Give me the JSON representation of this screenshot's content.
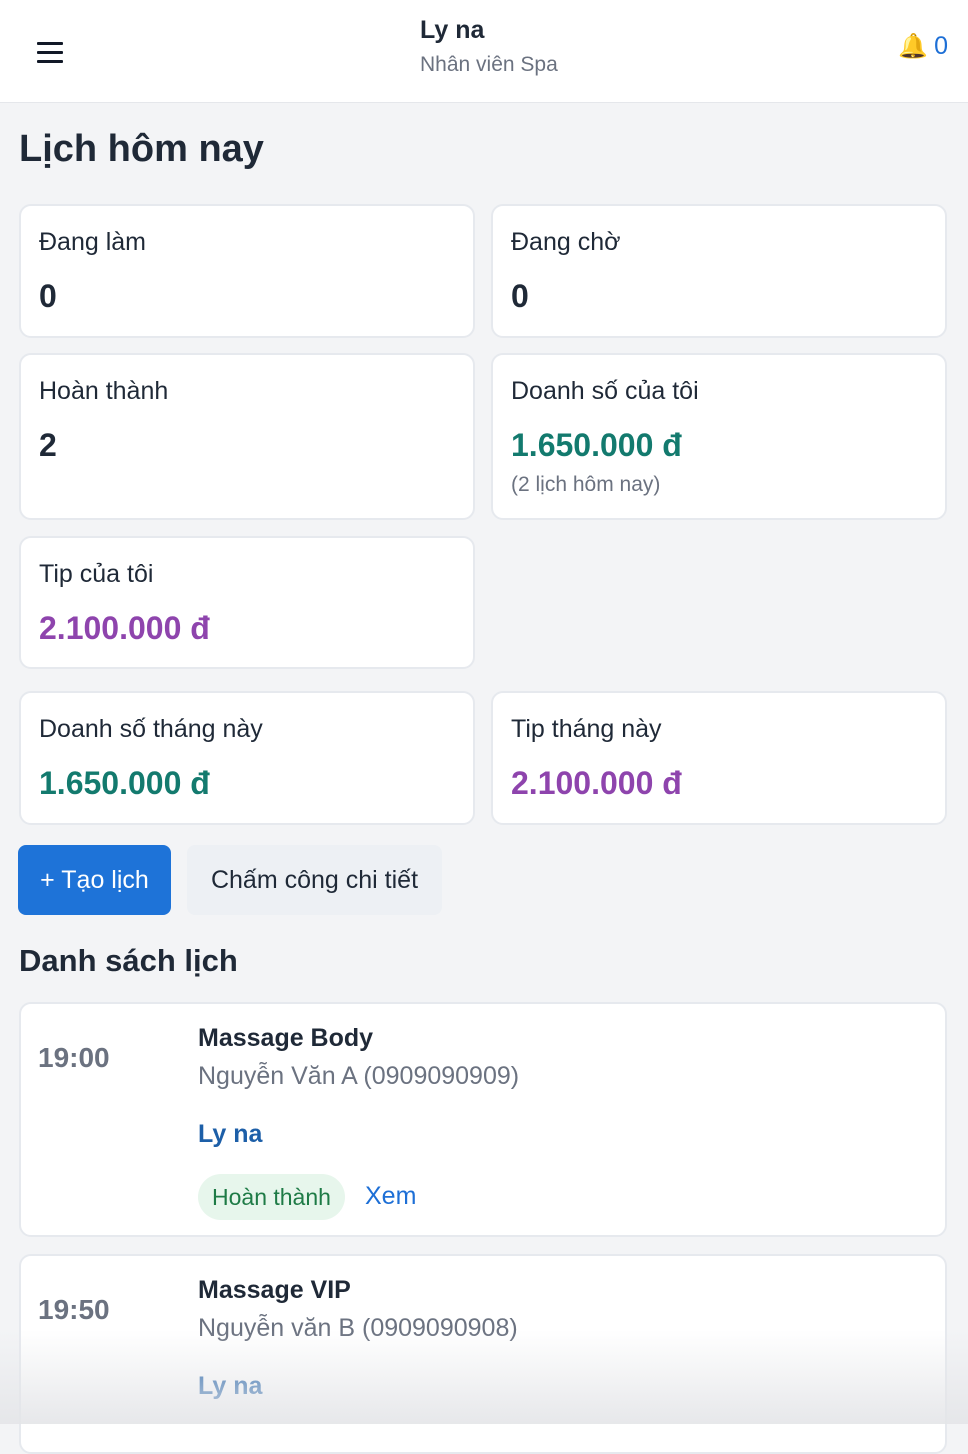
{
  "header": {
    "user_name": "Ly na",
    "user_role": "Nhân viên Spa",
    "notification_count": "0"
  },
  "page_title": "Lịch hôm nay",
  "stats": {
    "in_progress": {
      "label": "Đang làm",
      "value": "0"
    },
    "waiting": {
      "label": "Đang chờ",
      "value": "0"
    },
    "completed": {
      "label": "Hoàn thành",
      "value": "2"
    },
    "my_sales": {
      "label": "Doanh số của tôi",
      "value": "1.650.000 đ",
      "sub": "(2 lịch hôm nay)"
    },
    "my_tip": {
      "label": "Tip của tôi",
      "value": "2.100.000 đ"
    },
    "month_sales": {
      "label": "Doanh số tháng này",
      "value": "1.650.000 đ"
    },
    "month_tip": {
      "label": "Tip tháng này",
      "value": "2.100.000 đ"
    }
  },
  "actions": {
    "create_label": "+ Tạo lịch",
    "timesheet_label": "Chấm công chi tiết"
  },
  "list_title": "Danh sách lịch",
  "appointments": [
    {
      "time": "19:00",
      "service": "Massage Body",
      "customer": "Nguyễn Văn A (0909090909)",
      "staff": "Ly na",
      "status": "Hoàn thành",
      "view_label": "Xem"
    },
    {
      "time": "19:50",
      "service": "Massage VIP",
      "customer": "Nguyễn văn B (0909090908)",
      "staff": "Ly na"
    }
  ],
  "colors": {
    "primary": "#1e73d8",
    "sales_green": "#137a6e",
    "tip_purple": "#8e44ad",
    "status_green_bg": "#e7f6ec",
    "status_green_text": "#1e7b46"
  },
  "icons": {
    "menu": "hamburger-menu-icon",
    "notification": "bell-icon"
  }
}
